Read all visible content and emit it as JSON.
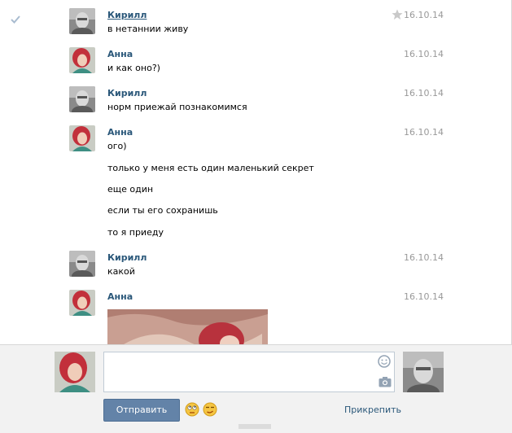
{
  "messages": [
    {
      "author": "Кирилл",
      "author_link": true,
      "avatar": "kirill",
      "date": "16.10.14",
      "starred": true,
      "checked": true,
      "lines": [
        "в нетаннии живу"
      ]
    },
    {
      "author": "Анна",
      "avatar": "anna",
      "date": "16.10.14",
      "lines": [
        "и как оно?)"
      ]
    },
    {
      "author": "Кирилл",
      "avatar": "kirill",
      "date": "16.10.14",
      "lines": [
        "норм приежай познакомимся"
      ]
    },
    {
      "author": "Анна",
      "avatar": "anna",
      "date": "16.10.14",
      "lines": [
        "ого)",
        "только у меня есть один маленький секрет",
        "еще один",
        "если ты его сохранишь",
        "то я приеду"
      ]
    },
    {
      "author": "Кирилл",
      "avatar": "kirill",
      "date": "16.10.14",
      "lines": [
        "какой"
      ]
    },
    {
      "author": "Анна",
      "avatar": "anna",
      "date": "16.10.14",
      "lines": [],
      "photo": true
    }
  ],
  "composer": {
    "input_value": "",
    "send_label": "Отправить",
    "attach_label": "Прикрепить",
    "icons": [
      "smile-icon",
      "camera-icon",
      "rolling-eyes-emoji",
      "smirk-emoji"
    ]
  },
  "colors": {
    "link": "#2b587a",
    "button": "#6383a8",
    "date": "#999999"
  }
}
